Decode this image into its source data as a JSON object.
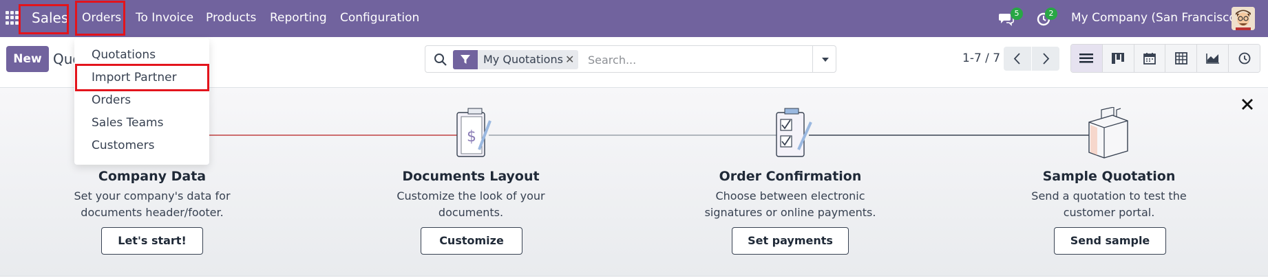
{
  "navbar": {
    "brand": "Sales",
    "menu": [
      "Orders",
      "To Invoice",
      "Products",
      "Reporting",
      "Configuration"
    ],
    "messages_count": "5",
    "activities_count": "2",
    "company": "My Company (San Francisco)",
    "color": "#71639e"
  },
  "dropdown": {
    "items": [
      "Quotations",
      "Import Partner",
      "Orders",
      "Sales Teams",
      "Customers"
    ]
  },
  "control": {
    "new_label": "New",
    "title_partial": "Quo",
    "facet": "My Quotations",
    "search_placeholder": "Search...",
    "pager": "1-7 / 7"
  },
  "onboarding": {
    "steps": [
      {
        "title": "Company Data",
        "desc": "Set your company's data for documents header/footer.",
        "button": "Let's start!"
      },
      {
        "title": "Documents Layout",
        "desc": "Customize the look of your documents.",
        "button": "Customize"
      },
      {
        "title": "Order Confirmation",
        "desc": "Choose between electronic signatures or online payments.",
        "button": "Set payments"
      },
      {
        "title": "Sample Quotation",
        "desc": "Send a quotation to test the customer portal.",
        "button": "Send sample"
      }
    ]
  },
  "highlight_color": "#e3141c"
}
